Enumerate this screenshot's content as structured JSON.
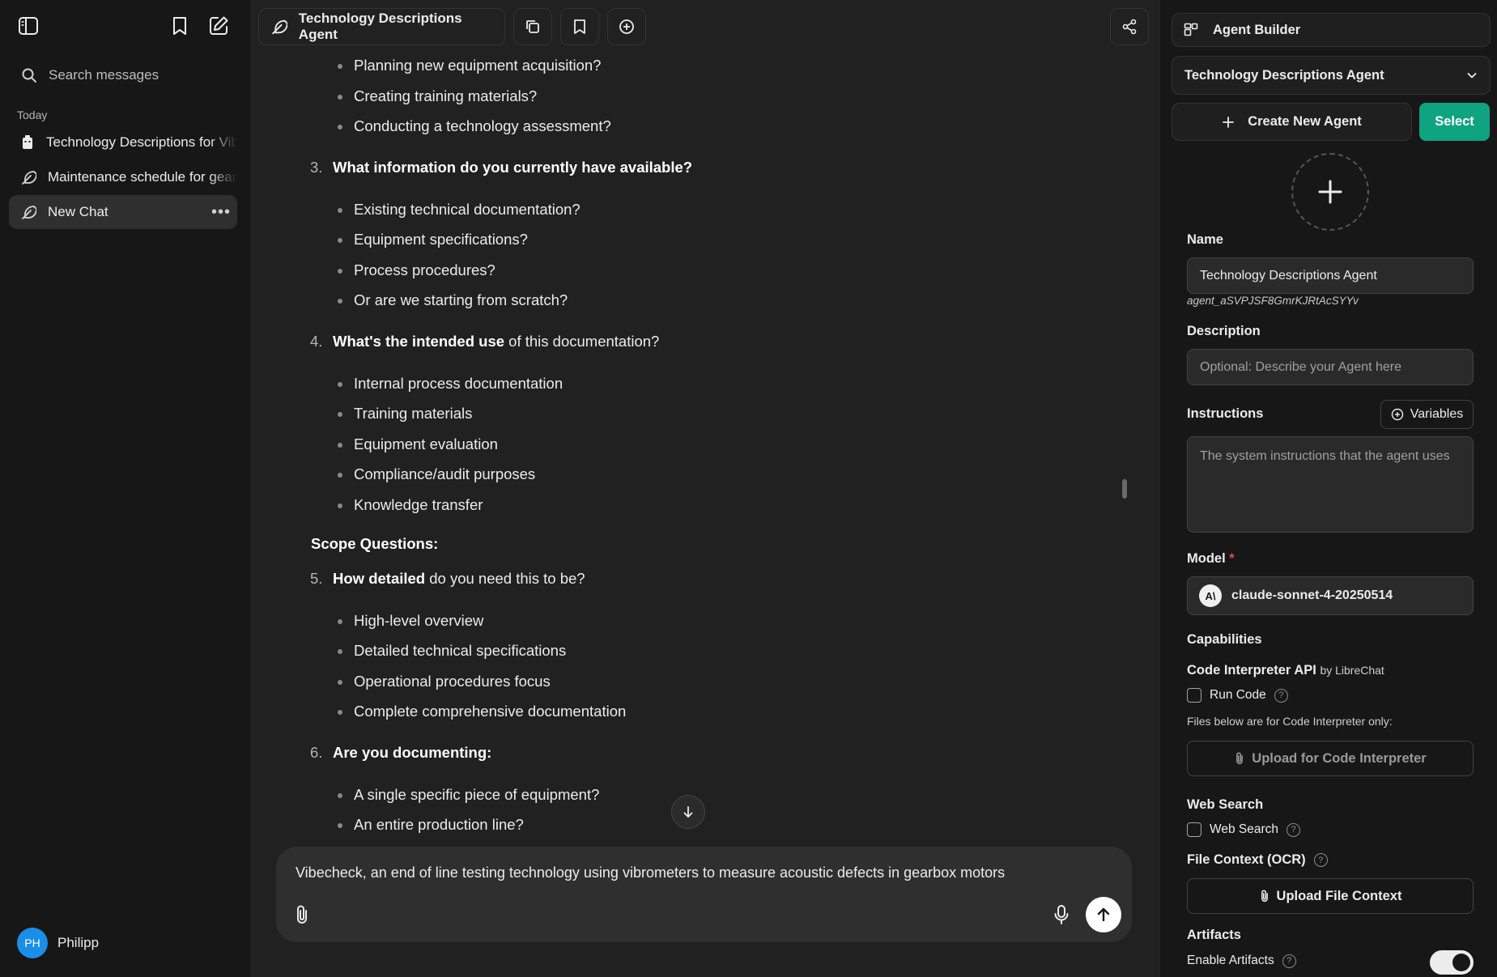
{
  "sidebar": {
    "search_placeholder": "Search messages",
    "section_today": "Today",
    "conversations": [
      {
        "label": "Technology Descriptions for Vibecheck"
      },
      {
        "label": "Maintenance schedule for gearbox"
      },
      {
        "label": "New Chat"
      }
    ],
    "user": {
      "initials": "PH",
      "name": "Philipp"
    }
  },
  "header": {
    "agent_name": "Technology Descriptions Agent"
  },
  "chat": {
    "bullets_top": [
      "Planning new equipment acquisition?",
      "Creating training materials?",
      "Conducting a technology assessment?"
    ],
    "q3": {
      "num": "3.",
      "bold": "What information do you currently have available?"
    },
    "bullets_q3": [
      "Existing technical documentation?",
      "Equipment specifications?",
      "Process procedures?",
      "Or are we starting from scratch?"
    ],
    "q4": {
      "num": "4.",
      "bold": "What's the intended use",
      "rest": " of this documentation?"
    },
    "bullets_q4": [
      "Internal process documentation",
      "Training materials",
      "Equipment evaluation",
      "Compliance/audit purposes",
      "Knowledge transfer"
    ],
    "scope_heading": "Scope Questions:",
    "q5": {
      "num": "5.",
      "bold": "How detailed",
      "rest": " do you need this to be?"
    },
    "bullets_q5": [
      "High-level overview",
      "Detailed technical specifications",
      "Operational procedures focus",
      "Complete comprehensive documentation"
    ],
    "q6": {
      "num": "6.",
      "bold": "Are you documenting:"
    },
    "bullets_q6": [
      "A single specific piece of equipment?",
      "An entire production line?"
    ],
    "composer_text": "Vibecheck, an end of line testing technology using vibrometers to measure acoustic defects in gearbox motors"
  },
  "panel": {
    "title": "Agent Builder",
    "selected_agent": "Technology Descriptions Agent",
    "create_new_label": "Create New Agent",
    "select_label": "Select",
    "name_label": "Name",
    "name_value": "Technology Descriptions Agent",
    "agent_id": "agent_aSVPJSF8GmrKJRtAcSYYv",
    "description_label": "Description",
    "description_placeholder": "Optional: Describe your Agent here",
    "instructions_label": "Instructions",
    "variables_label": "Variables",
    "instructions_placeholder": "The system instructions that the agent uses",
    "model_label": "Model",
    "model_required": "*",
    "model_value": "claude-sonnet-4-20250514",
    "capabilities_label": "Capabilities",
    "code_interpreter_label": "Code Interpreter API",
    "code_interpreter_by": "by LibreChat",
    "run_code_label": "Run Code",
    "files_note": "Files below are for Code Interpreter only:",
    "upload_ci_label": "Upload for Code Interpreter",
    "web_search_heading": "Web Search",
    "web_search_label": "Web Search",
    "file_context_label": "File Context (OCR)",
    "upload_file_context_label": "Upload File Context",
    "artifacts_label": "Artifacts",
    "enable_artifacts_label": "Enable Artifacts",
    "enable_artifacts_on": true
  },
  "colors": {
    "accent_green": "#10a37f",
    "avatar_blue": "#1a8ee8",
    "required_red": "#ef4444"
  }
}
